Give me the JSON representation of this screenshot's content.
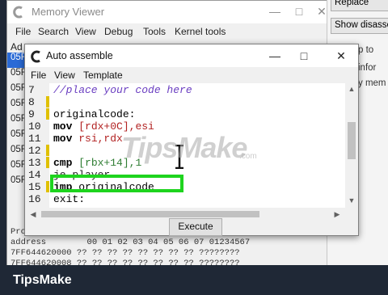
{
  "memory_viewer": {
    "title": "Memory Viewer",
    "menu": [
      "File",
      "Search",
      "View",
      "Debug",
      "Tools",
      "Kernel tools"
    ],
    "addr_label": "Ad",
    "side_items": [
      "05F",
      "05F",
      "05F",
      "05F",
      "05F",
      "05F",
      "05F",
      "05F",
      "05F"
    ],
    "bottom_header": "Pro",
    "bottom_lines": [
      "address        00 01 02 03 04 05 06 07 01234567",
      "7FF644620000 ?? ?? ?? ?? ?? ?? ?? ?? ????????",
      "7FF644620008 ?? ?? ?? ?? ?? ?? ?? ?? ????????"
    ]
  },
  "right_panel": {
    "buttons": [
      "Replace",
      "Show disassembler"
    ],
    "texts": [
      "p to",
      "infor",
      "y mem"
    ]
  },
  "auto_assemble": {
    "title": "Auto assemble",
    "menu": [
      "File",
      "View",
      "Template"
    ],
    "line_numbers": [
      "7",
      "8",
      "9",
      "10",
      "11",
      "12",
      "13",
      "14",
      "15",
      "16"
    ],
    "code": {
      "l7": "//place your code here",
      "l8": "",
      "l9": "originalcode:",
      "l10_op": "mov ",
      "l10_a": "[rdx+0C]",
      "l10_b": ",esi",
      "l11_op": "mov ",
      "l11_a": "rsi",
      "l11_b": ",rdx",
      "l12": "",
      "l13_op": "cmp ",
      "l13_a": "[rbx+14]",
      "l13_b": ",1",
      "l14": "je player",
      "l15_op": "jmp",
      "l15_b": " originalcode",
      "l16": "exit:"
    },
    "execute_label": "Execute"
  },
  "watermark": {
    "text": "TipsMake",
    "suffix": ".com"
  },
  "footer": {
    "brand": "TipsMake"
  },
  "colors": {
    "highlight": "#1ed41e",
    "selection": "#2a6ad6",
    "footer_bg": "#1f2836"
  }
}
